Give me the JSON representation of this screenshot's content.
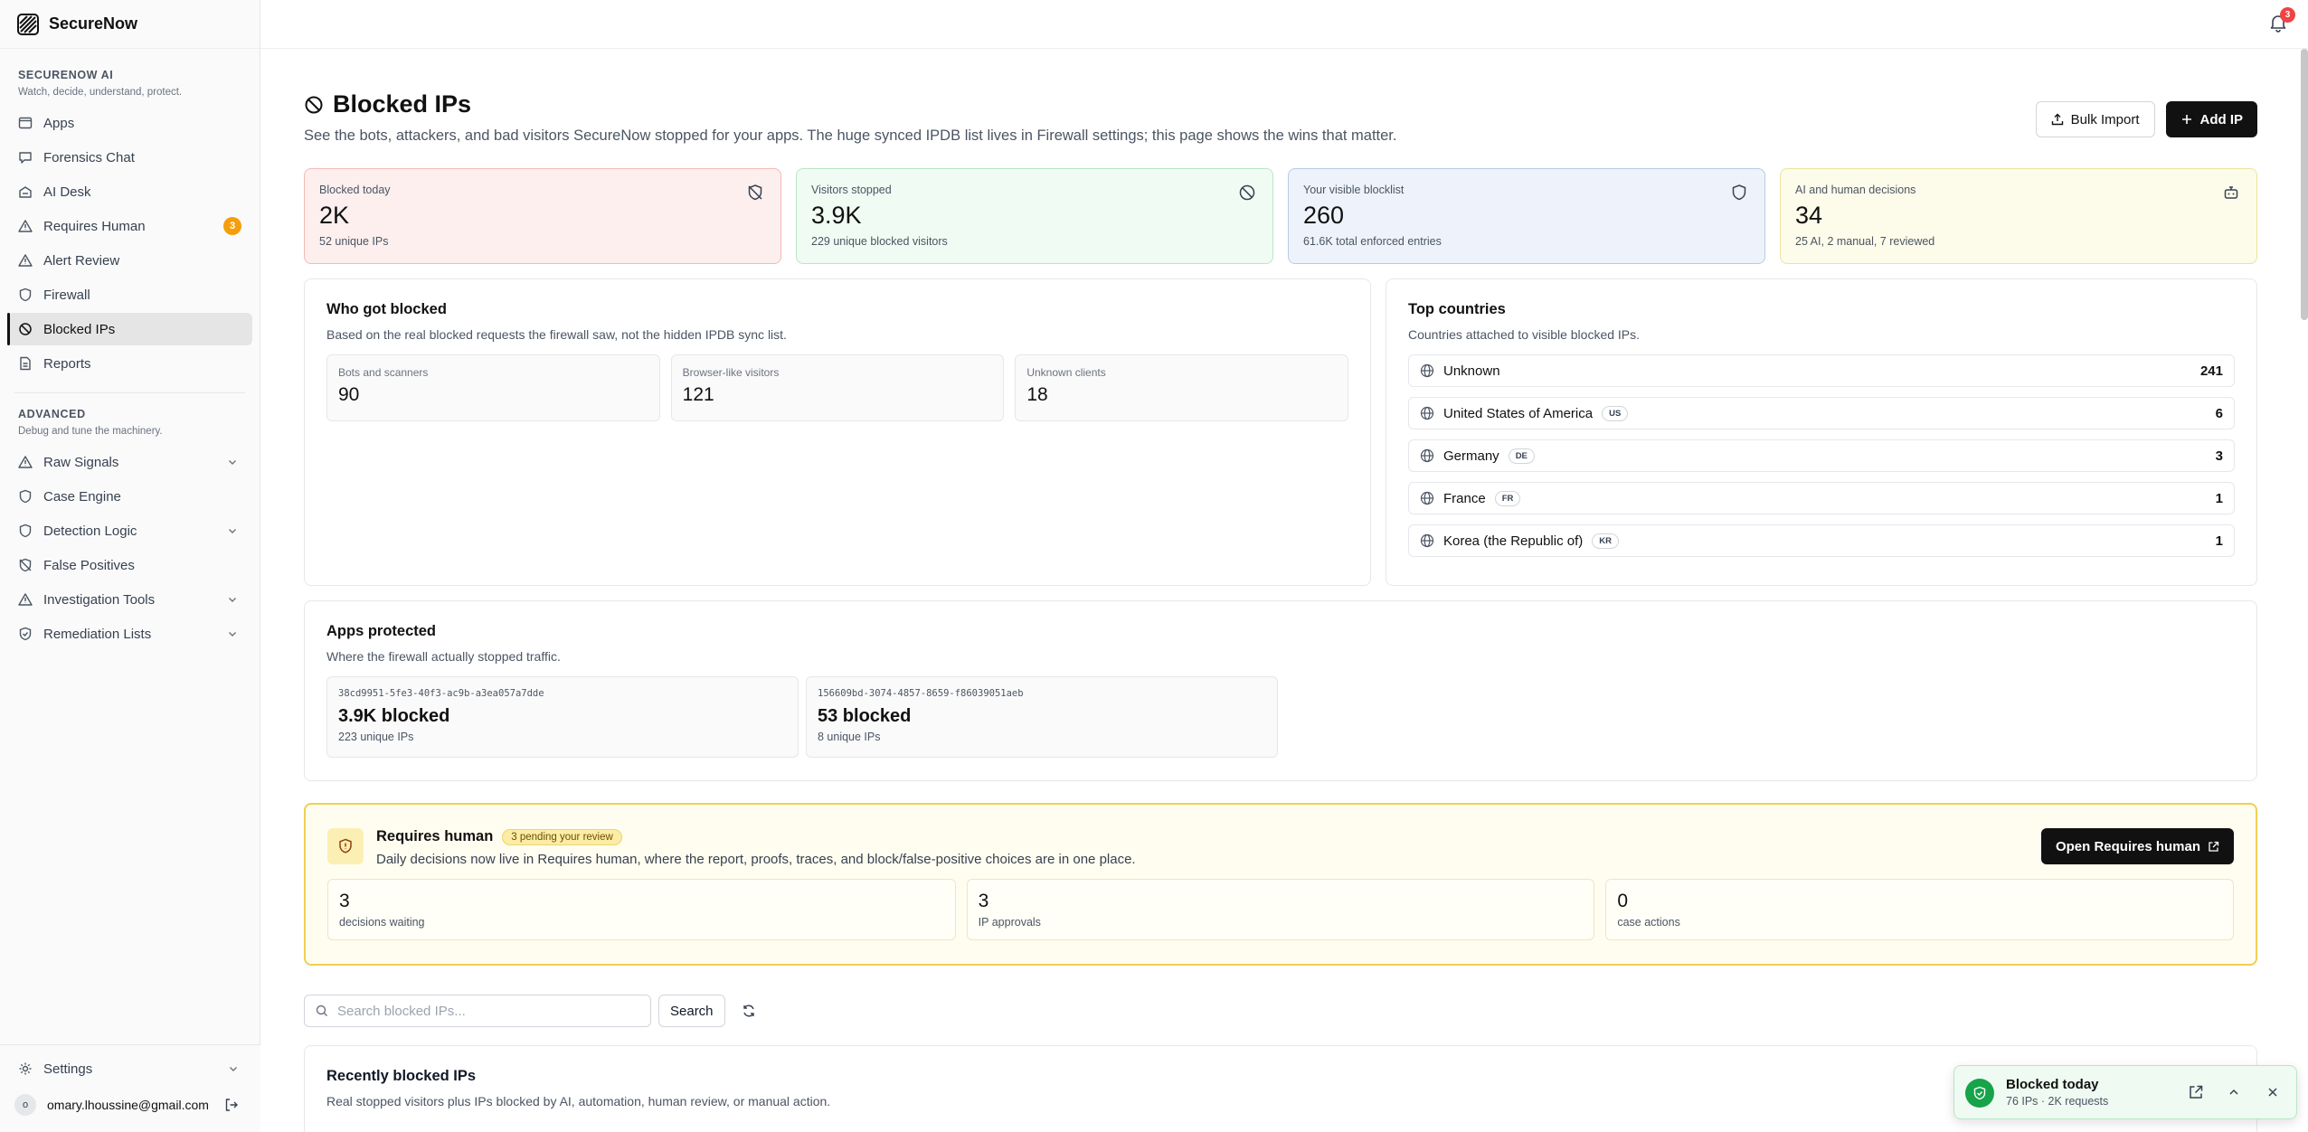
{
  "brand": {
    "name": "SecureNow"
  },
  "sidebar": {
    "section_ai": {
      "title": "SECURENOW AI",
      "subtitle": "Watch, decide, understand, protect."
    },
    "items_ai": [
      {
        "label": "Apps",
        "icon": "window-icon"
      },
      {
        "label": "Forensics Chat",
        "icon": "chat-icon"
      },
      {
        "label": "AI Desk",
        "icon": "desk-icon"
      },
      {
        "label": "Requires Human",
        "icon": "warning-icon",
        "badge": "3"
      },
      {
        "label": "Alert Review",
        "icon": "alert-icon"
      },
      {
        "label": "Firewall",
        "icon": "shield-icon"
      },
      {
        "label": "Blocked IPs",
        "icon": "ban-icon",
        "active": true
      },
      {
        "label": "Reports",
        "icon": "document-icon"
      }
    ],
    "section_adv": {
      "title": "ADVANCED",
      "subtitle": "Debug and tune the machinery."
    },
    "items_adv": [
      {
        "label": "Raw Signals",
        "icon": "warning-icon",
        "expandable": true
      },
      {
        "label": "Case Engine",
        "icon": "shield-icon"
      },
      {
        "label": "Detection Logic",
        "icon": "shield-icon",
        "expandable": true
      },
      {
        "label": "False Positives",
        "icon": "shield-off-icon"
      },
      {
        "label": "Investigation Tools",
        "icon": "warning-icon",
        "expandable": true
      },
      {
        "label": "Remediation Lists",
        "icon": "shield-check-icon",
        "expandable": true
      }
    ],
    "settings_label": "Settings",
    "user": {
      "initial": "o",
      "email": "omary.lhoussine@gmail.com"
    }
  },
  "topbar": {
    "notifications_count": "3"
  },
  "page": {
    "title": "Blocked IPs",
    "subtitle": "See the bots, attackers, and bad visitors SecureNow stopped for your apps. The huge synced IPDB list lives in Firewall settings; this page shows the wins that matter.",
    "bulk_import_label": "Bulk Import",
    "add_ip_label": "Add IP"
  },
  "stats": [
    {
      "label": "Blocked today",
      "value": "2K",
      "sub": "52 unique IPs",
      "icon": "shield-off-icon",
      "tone": "red"
    },
    {
      "label": "Visitors stopped",
      "value": "3.9K",
      "sub": "229 unique blocked visitors",
      "icon": "ban-icon",
      "tone": "green"
    },
    {
      "label": "Your visible blocklist",
      "value": "260",
      "sub": "61.6K total enforced entries",
      "icon": "shield-icon",
      "tone": "blue"
    },
    {
      "label": "AI and human decisions",
      "value": "34",
      "sub": "25 AI, 2 manual, 7 reviewed",
      "icon": "bot-icon",
      "tone": "yellow"
    }
  ],
  "who_blocked": {
    "title": "Who got blocked",
    "desc": "Based on the real blocked requests the firewall saw, not the hidden IPDB sync list.",
    "items": [
      {
        "label": "Bots and scanners",
        "value": "90"
      },
      {
        "label": "Browser-like visitors",
        "value": "121"
      },
      {
        "label": "Unknown clients",
        "value": "18"
      }
    ]
  },
  "top_countries": {
    "title": "Top countries",
    "desc": "Countries attached to visible blocked IPs.",
    "items": [
      {
        "name": "Unknown",
        "code": "",
        "count": "241"
      },
      {
        "name": "United States of America",
        "code": "US",
        "count": "6"
      },
      {
        "name": "Germany",
        "code": "DE",
        "count": "3"
      },
      {
        "name": "France",
        "code": "FR",
        "count": "1"
      },
      {
        "name": "Korea (the Republic of)",
        "code": "KR",
        "count": "1"
      }
    ]
  },
  "apps_protected": {
    "title": "Apps protected",
    "desc": "Where the firewall actually stopped traffic.",
    "apps": [
      {
        "id": "38cd9951-5fe3-40f3-ac9b-a3ea057a7dde",
        "blocked": "3.9K blocked",
        "unique": "223 unique IPs"
      },
      {
        "id": "156609bd-3074-4857-8659-f86039051aeb",
        "blocked": "53 blocked",
        "unique": "8 unique IPs"
      }
    ]
  },
  "requires_human": {
    "title": "Requires human",
    "pill": "3 pending your review",
    "desc": "Daily decisions now live in Requires human, where the report, proofs, traces, and block/false-positive choices are in one place.",
    "button": "Open Requires human",
    "stats": [
      {
        "value": "3",
        "label": "decisions waiting"
      },
      {
        "value": "3",
        "label": "IP approvals"
      },
      {
        "value": "0",
        "label": "case actions"
      }
    ]
  },
  "search": {
    "placeholder": "Search blocked IPs...",
    "button": "Search"
  },
  "recent": {
    "title": "Recently blocked IPs",
    "desc": "Real stopped visitors plus IPs blocked by AI, automation, human review, or manual action."
  },
  "toast": {
    "title": "Blocked today",
    "sub": "76 IPs · 2K requests"
  }
}
